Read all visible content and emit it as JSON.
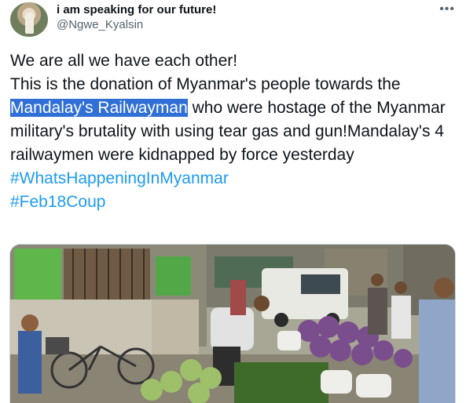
{
  "tweet": {
    "display_name": "i am speaking for our future!",
    "handle": "@Ngwe_Kyalsin",
    "more_icon": "more-icon",
    "text_line1": "We are all we have each other!",
    "text_line2_pre": "This is the donation of Myanmar's people towards the",
    "text_highlight": "Mandalay's Railwayman",
    "text_line2_post": " who were hostage of the Myanmar military's brutality with using tear gas and gun!Mandalay's 4 railwaymen were kidnapped by force yesterday",
    "hashtags": [
      "#WhatsHappeningInMyanmar",
      "#Feb18Coup"
    ],
    "highlight_color": "#2f6fd6",
    "hashtag_color": "#1d9bf0"
  }
}
